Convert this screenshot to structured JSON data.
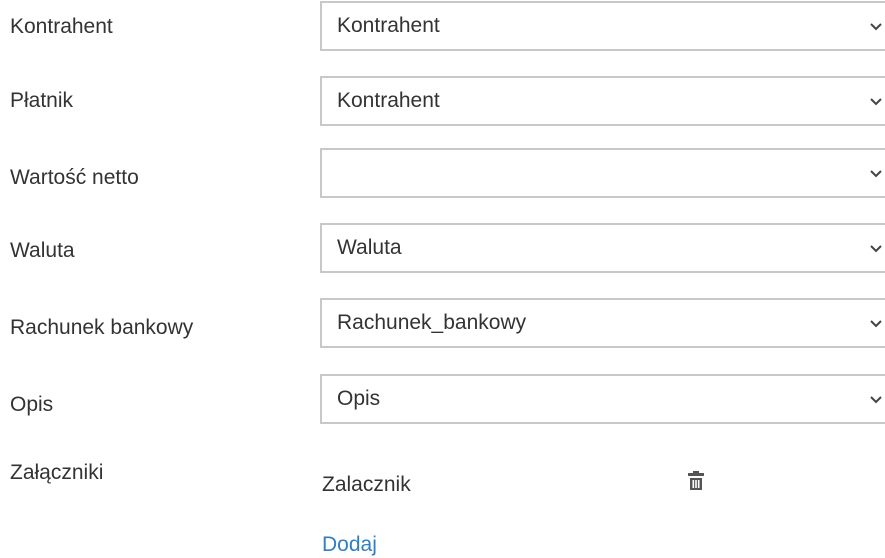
{
  "fields": [
    {
      "label": "Kontrahent",
      "value": "Kontrahent"
    },
    {
      "label": "Płatnik",
      "value": "Kontrahent"
    },
    {
      "label": "Wartość netto",
      "value": ""
    },
    {
      "label": "Waluta",
      "value": "Waluta"
    },
    {
      "label": "Rachunek bankowy",
      "value": "Rachunek_bankowy"
    },
    {
      "label": "Opis",
      "value": "Opis"
    }
  ],
  "attachments": {
    "label": "Załączniki",
    "items": [
      {
        "name": "Zalacznik",
        "delete_icon": "trash-icon"
      }
    ],
    "add_label": "Dodaj"
  },
  "colors": {
    "text": "#333333",
    "border": "#c8c8c8",
    "link": "#2f7fc1"
  }
}
